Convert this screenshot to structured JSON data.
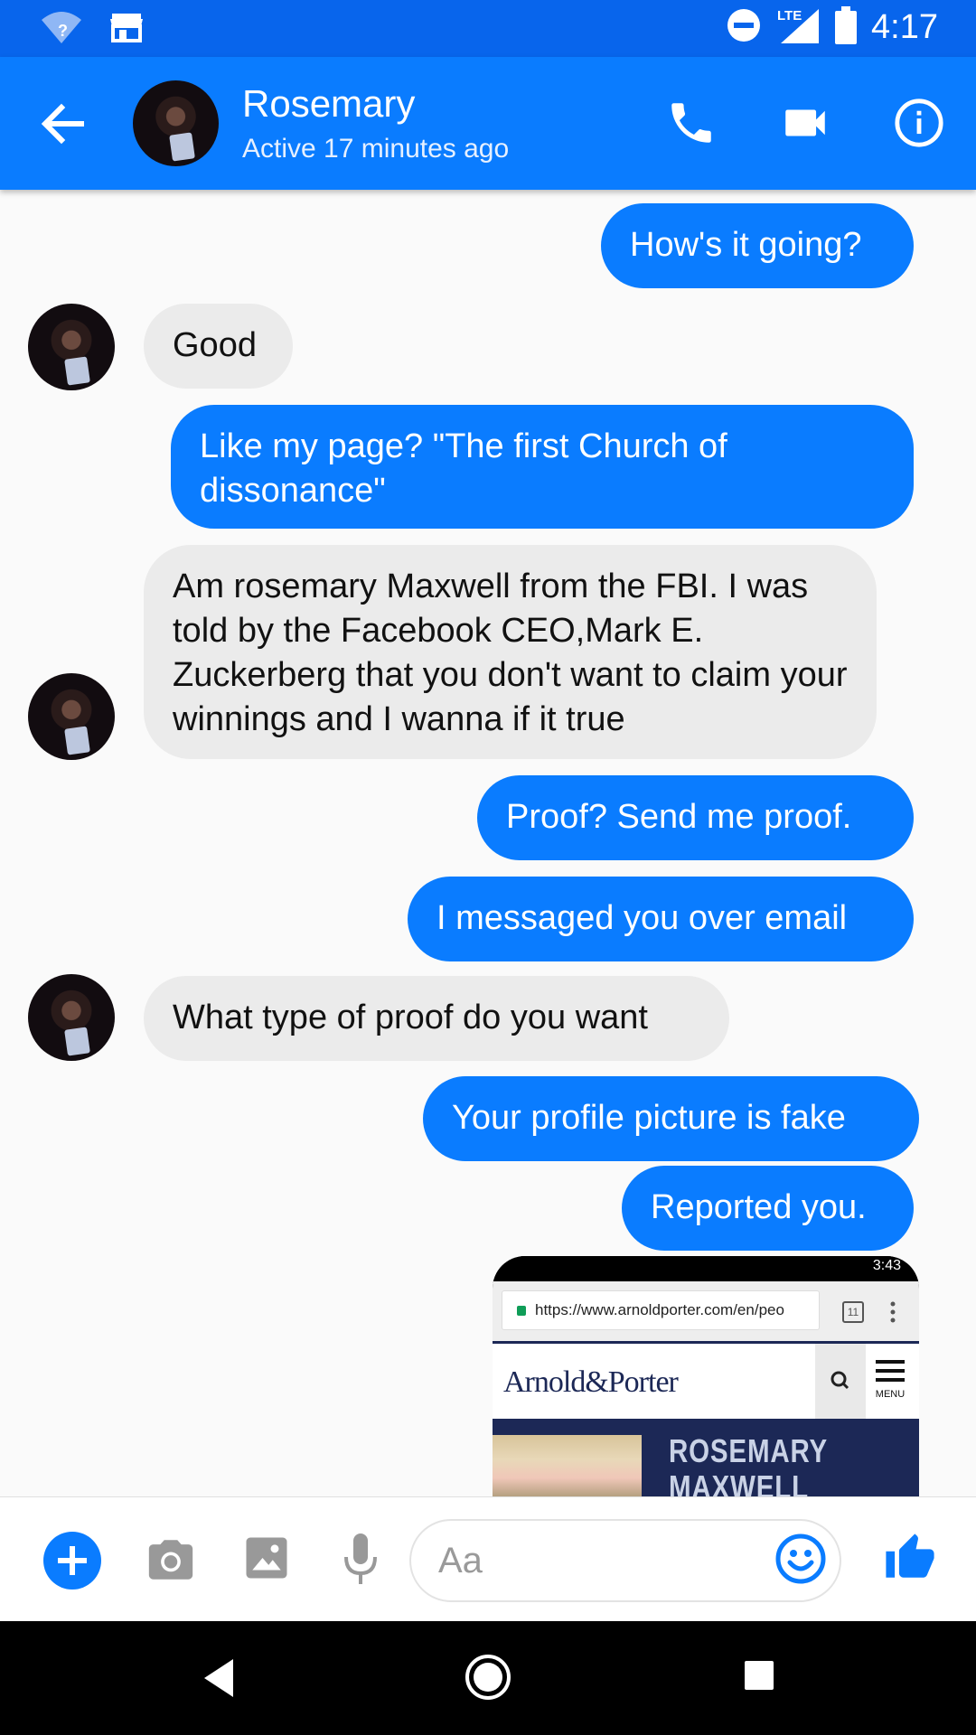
{
  "status_bar": {
    "time": "4:17",
    "network": "LTE",
    "icons": [
      "wifi-unknown-icon",
      "store-icon",
      "do-not-disturb-icon",
      "lte-signal-icon",
      "battery-icon"
    ]
  },
  "header": {
    "name": "Rosemary",
    "status": "Active 17 minutes ago",
    "icons": [
      "back-arrow-icon",
      "phone-icon",
      "video-camera-icon",
      "info-icon"
    ]
  },
  "colors": {
    "brand": "#0a7cff",
    "status_bar": "#0865ec",
    "incoming_bubble": "#ebebeb",
    "background": "#fafafa"
  },
  "messages": [
    {
      "dir": "out",
      "text": "How's it going?"
    },
    {
      "dir": "in",
      "text": "Good"
    },
    {
      "dir": "out",
      "text": "Like my page? \"The first Church of dissonance\""
    },
    {
      "dir": "in",
      "text": "Am rosemary Maxwell from the FBI. I was told by the Facebook CEO,Mark E. Zuckerberg that you don't want to claim your winnings and I wanna if it true"
    },
    {
      "dir": "out",
      "text": "Proof? Send me proof."
    },
    {
      "dir": "out",
      "text": "I messaged you over email"
    },
    {
      "dir": "in",
      "text": "What type of proof do you want"
    },
    {
      "dir": "out",
      "text": "Your profile picture is fake"
    },
    {
      "dir": "out",
      "text": "Reported you."
    }
  ],
  "attachment": {
    "time": "3:43",
    "url": "https://www.arnoldporter.com/en/peo",
    "tab_count": "11",
    "site_logo": "Arnold&Porter",
    "menu_label": "MENU",
    "profile_name": "ROSEMARY MAXWELL"
  },
  "composer": {
    "placeholder": "Aa",
    "value": ""
  }
}
